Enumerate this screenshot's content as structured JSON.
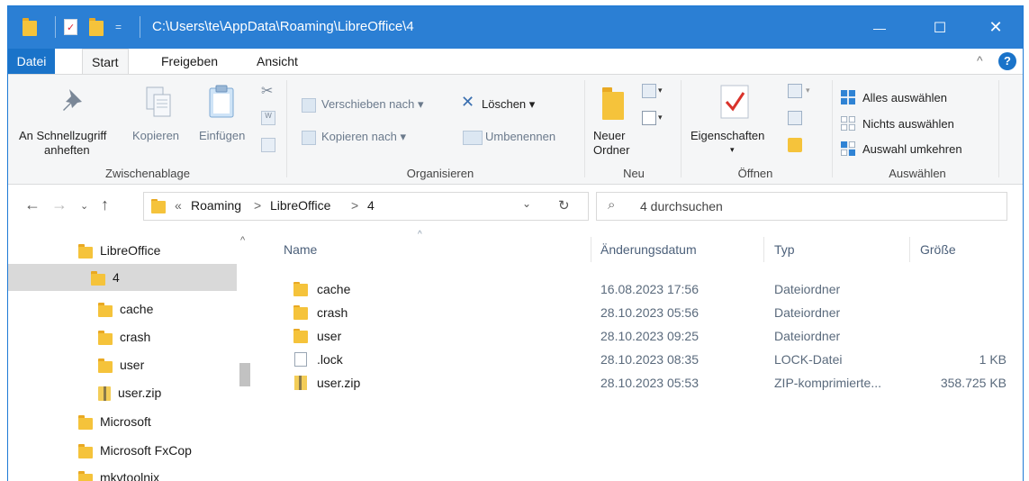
{
  "titlebar": {
    "path": "C:\\Users\\te\\AppData\\Roaming\\LibreOffice\\4",
    "qat_dropdown": "=",
    "minimize": "—",
    "maximize": "☐",
    "close": "✕",
    "accent": "#2b7fd4"
  },
  "menu": {
    "tabs": [
      "Datei",
      "Start",
      "Freigeben",
      "Ansicht"
    ],
    "collapse": "^",
    "help": "?"
  },
  "ribbon": {
    "clipboard": {
      "pin_line1": "An Schnellzugriff",
      "pin_line2": "anheften",
      "copy": "Kopieren",
      "paste": "Einfügen",
      "label": "Zwischenablage"
    },
    "organize": {
      "move_to": "Verschieben nach",
      "copy_to": "Kopieren nach",
      "delete": "Löschen",
      "rename": "Umbenennen",
      "label": "Organisieren"
    },
    "new": {
      "new_folder_line1": "Neuer",
      "new_folder_line2": "Ordner",
      "label": "Neu"
    },
    "open": {
      "properties": "Eigenschaften",
      "label": "Öffnen"
    },
    "select": {
      "select_all": "Alles auswählen",
      "select_none": "Nichts auswählen",
      "invert": "Auswahl umkehren",
      "label": "Auswählen"
    }
  },
  "address": {
    "prefix": "«",
    "crumbs": [
      "Roaming",
      "LibreOffice",
      "4"
    ],
    "separator": ">",
    "search_placeholder": "4 durchsuchen"
  },
  "nav": {
    "items": [
      {
        "label": "LibreOffice",
        "level": 0,
        "selected": false
      },
      {
        "label": "4",
        "level": 1,
        "selected": true
      },
      {
        "label": "cache",
        "level": 2,
        "selected": false
      },
      {
        "label": "crash",
        "level": 2,
        "selected": false
      },
      {
        "label": "user",
        "level": 2,
        "selected": false
      },
      {
        "label": "user.zip",
        "level": 2,
        "selected": false,
        "type": "zip"
      },
      {
        "label": "Microsoft",
        "level": 0,
        "selected": false
      },
      {
        "label": "Microsoft FxCop",
        "level": 0,
        "selected": false
      },
      {
        "label": "mkvtoolnix",
        "level": 0,
        "selected": false
      }
    ]
  },
  "files": {
    "columns": [
      "Name",
      "Änderungsdatum",
      "Typ",
      "Größe"
    ],
    "rows": [
      {
        "name": "cache",
        "date": "16.08.2023 17:56",
        "type": "Dateiordner",
        "size": "",
        "icon": "folder"
      },
      {
        "name": "crash",
        "date": "28.10.2023 05:56",
        "type": "Dateiordner",
        "size": "",
        "icon": "folder"
      },
      {
        "name": "user",
        "date": "28.10.2023 09:25",
        "type": "Dateiordner",
        "size": "",
        "icon": "folder"
      },
      {
        "name": ".lock",
        "date": "28.10.2023 08:35",
        "type": "LOCK-Datei",
        "size": "1 KB",
        "icon": "file"
      },
      {
        "name": "user.zip",
        "date": "28.10.2023 05:53",
        "type": "ZIP-komprimierte...",
        "size": "358.725 KB",
        "icon": "zip"
      }
    ]
  }
}
